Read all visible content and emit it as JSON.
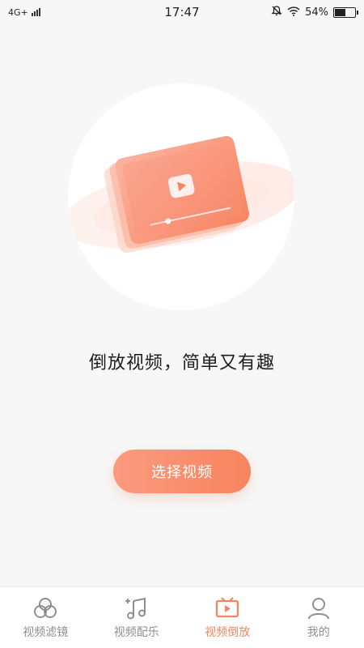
{
  "status_bar": {
    "network": "4G+",
    "time": "17:47",
    "battery": "54%",
    "battery_level": 0.54,
    "icons": [
      "signal-icon",
      "mute-icon",
      "wifi-icon",
      "battery-icon"
    ]
  },
  "hero": {
    "illustration": "video-card-illustration",
    "icon": "play-icon"
  },
  "tagline": "倒放视频，简单又有趣",
  "action": {
    "select_label": "选择视频"
  },
  "colors": {
    "accent": "#f7845f",
    "tab_inactive": "#8f8f8f",
    "background": "#f7f7f7"
  },
  "tabs": [
    {
      "label": "视频滤镜",
      "icon": "filter-icon",
      "active": false
    },
    {
      "label": "视频配乐",
      "icon": "music-icon",
      "active": false
    },
    {
      "label": "视频倒放",
      "icon": "reverse-video-icon",
      "active": true
    },
    {
      "label": "我的",
      "icon": "profile-icon",
      "active": false
    }
  ]
}
